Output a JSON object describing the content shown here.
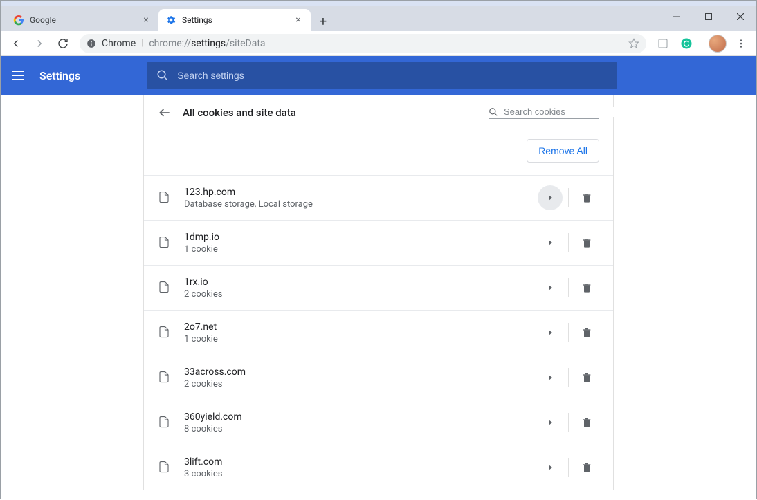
{
  "window": {
    "tabs": [
      {
        "label": "Google",
        "favicon": "google"
      },
      {
        "label": "Settings",
        "favicon": "gear"
      }
    ],
    "active_tab": 1
  },
  "toolbar": {
    "secure_label": "Chrome",
    "url_prefix": "chrome://",
    "url_bold": "settings",
    "url_suffix": "/siteData"
  },
  "settings_header": {
    "title": "Settings",
    "search_placeholder": "Search settings"
  },
  "panel": {
    "title": "All cookies and site data",
    "search_placeholder": "Search cookies",
    "remove_all_label": "Remove All"
  },
  "sites": [
    {
      "name": "123.hp.com",
      "desc": "Database storage, Local storage",
      "hover": true
    },
    {
      "name": "1dmp.io",
      "desc": "1 cookie",
      "hover": false
    },
    {
      "name": "1rx.io",
      "desc": "2 cookies",
      "hover": false
    },
    {
      "name": "2o7.net",
      "desc": "1 cookie",
      "hover": false
    },
    {
      "name": "33across.com",
      "desc": "2 cookies",
      "hover": false
    },
    {
      "name": "360yield.com",
      "desc": "8 cookies",
      "hover": false
    },
    {
      "name": "3lift.com",
      "desc": "3 cookies",
      "hover": false
    }
  ]
}
